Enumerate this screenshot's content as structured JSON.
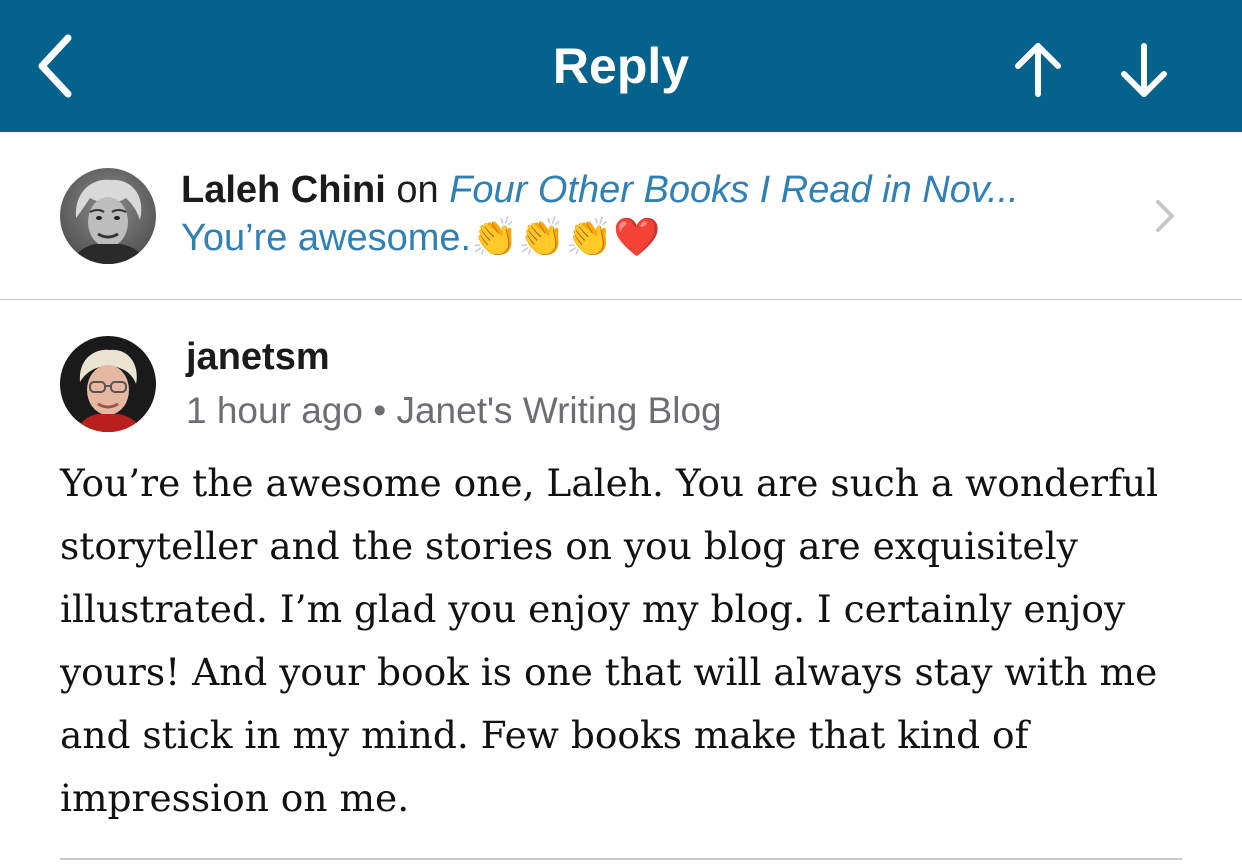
{
  "header": {
    "title": "Reply",
    "back_icon": "chevron-left-icon",
    "prev_icon": "arrow-up-icon",
    "next_icon": "arrow-down-icon",
    "background_color": "#04628c"
  },
  "parent_comment": {
    "author": "Laleh Chini",
    "connector": "on",
    "post_title": "Four Other Books I Read in Nov...",
    "excerpt": "You’re awesome.",
    "emojis": "👏👏👏❤️",
    "chevron_icon": "chevron-right-icon",
    "link_color": "#2f80b5"
  },
  "reply": {
    "author": "janetsm",
    "time": "1 hour ago",
    "separator": "•",
    "blog": "Janet's Writing Blog",
    "body": "You’re the awesome one, Laleh. You are such a wonderful storyteller and the stories on you blog are exquisitely illustrated. I’m glad you enjoy my blog. I certainly enjoy yours! And your book is one that will always stay with me and stick in my mind. Few books make that kind of impression on me."
  }
}
